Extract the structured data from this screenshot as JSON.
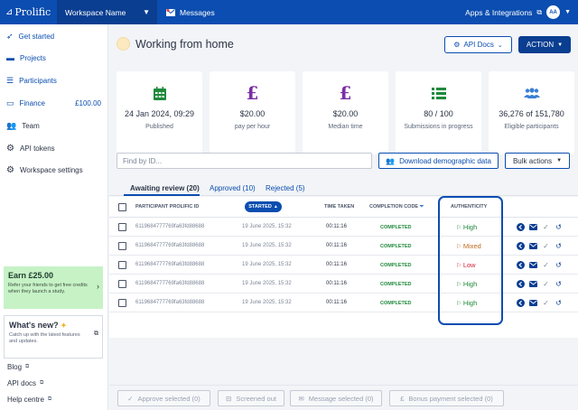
{
  "topbar": {
    "logo": "Prolific",
    "workspace": "Workspace Name",
    "messages": "Messages",
    "apps": "Apps & Integrations",
    "avatar": "AA"
  },
  "sidebar": {
    "items": [
      {
        "label": "Get started",
        "icon": "rocket-icon"
      },
      {
        "label": "Projects",
        "icon": "folder-icon"
      },
      {
        "label": "Participants",
        "icon": "list-icon"
      },
      {
        "label": "Finance",
        "icon": "wallet-icon",
        "amount": "£100.00"
      },
      {
        "label": "Team",
        "icon": "team-icon"
      },
      {
        "label": "API tokens",
        "icon": "gear-icon"
      },
      {
        "label": "Workspace settings",
        "icon": "gear-icon"
      }
    ],
    "earn": {
      "title": "Earn £25.00",
      "text": "Refer your friends to get free credits when they launch a study."
    },
    "whatsnew": {
      "title": "What's new?",
      "text": "Catch up with the latest features and updates."
    },
    "links": [
      "Blog",
      "API docs",
      "Help centre"
    ]
  },
  "header": {
    "title": "Working from home",
    "api_docs": "API Docs",
    "action": "ACTION"
  },
  "cards": [
    {
      "icon": "calendar-icon",
      "value": "24 Jan 2024, 09:29",
      "label": "Published"
    },
    {
      "icon": "pound-icon",
      "value": "$20.00",
      "label": "pay per hour"
    },
    {
      "icon": "pound-icon",
      "value": "$20.00",
      "label": "Median time"
    },
    {
      "icon": "list-icon",
      "value": "80 / 100",
      "label": "Submissions in progress"
    },
    {
      "icon": "people-icon",
      "value": "36,276 of 151,780",
      "label": "Eligible participants"
    }
  ],
  "toolbar": {
    "search_placeholder": "Find by ID...",
    "download": "Download demographic data",
    "bulk": "Bulk actions"
  },
  "tabs": [
    "Awaiting review (20)",
    "Approved (10)",
    "Rejected (5)"
  ],
  "table": {
    "headers": {
      "pid": "PARTICIPANT PROLIFIC ID",
      "started": "STARTED",
      "time": "TIME TAKEN",
      "code": "COMPLETION CODE",
      "auth": "AUTHENTICITY"
    },
    "rows": [
      {
        "pid": "6119684777769fa63fd88688",
        "started": "19 June 2025, 15:32",
        "time": "00:11:16",
        "code": "COMPLETED",
        "auth": "High"
      },
      {
        "pid": "6119684777769fa63fd88688",
        "started": "19 June 2025, 15:32",
        "time": "00:11:16",
        "code": "COMPLETED",
        "auth": "Mixed"
      },
      {
        "pid": "6119684777769fa63fd88688",
        "started": "19 June 2025, 15:32",
        "time": "00:11:16",
        "code": "COMPLETED",
        "auth": "Low"
      },
      {
        "pid": "6119684777769fa63fd88688",
        "started": "19 June 2025, 15:32",
        "time": "00:11:16",
        "code": "COMPLETED",
        "auth": "High"
      },
      {
        "pid": "6119684777769fa63fd88688",
        "started": "19 June 2025, 15:32",
        "time": "00:11:16",
        "code": "COMPLETED",
        "auth": "High"
      }
    ]
  },
  "bottom": {
    "approve": "Approve selected (0)",
    "screened": "Screened out",
    "message": "Message selected (0)",
    "bonus": "Bonus payment selected (0)"
  },
  "colors": {
    "brand": "#0b4db0",
    "high": "#1f8a3b",
    "mixed": "#c0691f",
    "low": "#d3263a",
    "purple": "#7b2ea7"
  }
}
